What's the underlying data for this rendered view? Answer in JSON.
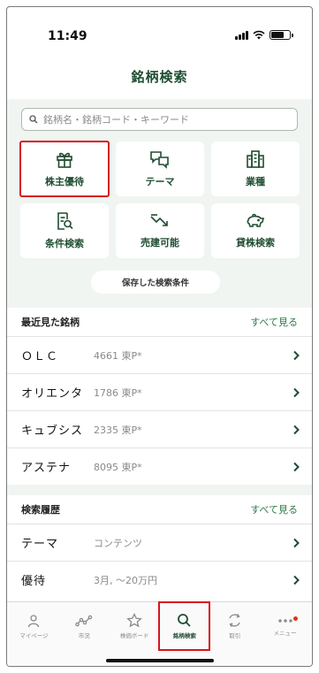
{
  "status_bar": {
    "time": "11:49"
  },
  "header": {
    "title": "銘柄検索"
  },
  "search": {
    "placeholder": "銘柄名・銘柄コード・キーワード"
  },
  "categories": [
    {
      "label": "株主優待",
      "icon": "gift-icon"
    },
    {
      "label": "テーマ",
      "icon": "chat-bubbles-icon"
    },
    {
      "label": "業種",
      "icon": "buildings-icon"
    },
    {
      "label": "条件検索",
      "icon": "document-search-icon"
    },
    {
      "label": "売建可能",
      "icon": "trend-down-icon"
    },
    {
      "label": "貸株検索",
      "icon": "piggy-bank-icon"
    }
  ],
  "saved_conditions_label": "保存した検索条件",
  "recent": {
    "title": "最近見た銘柄",
    "see_all": "すべて見る",
    "items": [
      {
        "name": "ＯＬＣ",
        "code": "4661 東P*"
      },
      {
        "name": "オリエンタ",
        "code": "1786 東P*"
      },
      {
        "name": "キュブシス",
        "code": "2335 東P*"
      },
      {
        "name": "アステナ",
        "code": "8095 東P*"
      }
    ]
  },
  "history": {
    "title": "検索履歴",
    "see_all": "すべて見る",
    "items": [
      {
        "name": "テーマ",
        "detail": "コンテンツ"
      },
      {
        "name": "優待",
        "detail": "3月, 〜20万円"
      }
    ]
  },
  "tabbar": [
    {
      "label": "マイページ",
      "icon": "person-icon"
    },
    {
      "label": "市況",
      "icon": "market-chart-icon"
    },
    {
      "label": "株価ボード",
      "icon": "star-icon"
    },
    {
      "label": "銘柄検索",
      "icon": "search-icon"
    },
    {
      "label": "取引",
      "icon": "trade-cycle-icon"
    },
    {
      "label": "メニュー",
      "icon": "more-icon"
    }
  ],
  "colors": {
    "brand_green": "#1f4d32",
    "accent_green": "#2d7a46",
    "highlight_red": "#d8151d",
    "background_tint": "#f1f5f1"
  }
}
